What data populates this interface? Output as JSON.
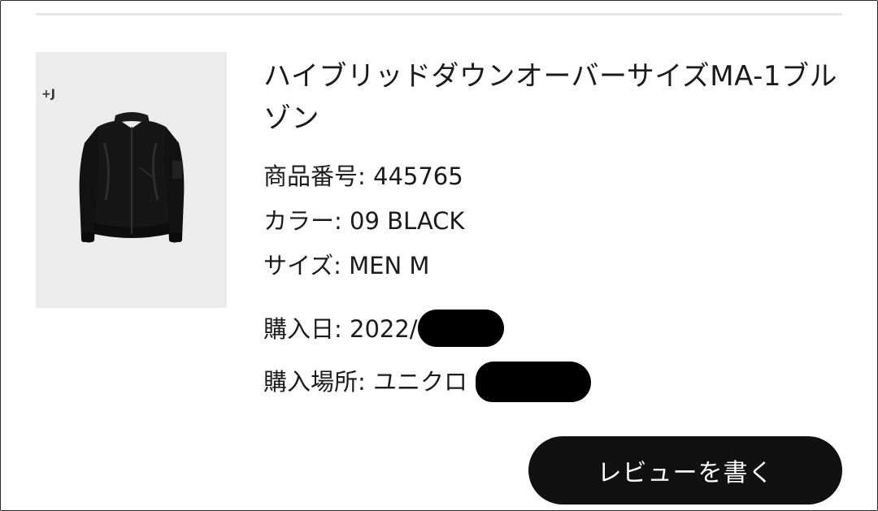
{
  "product": {
    "title": "ハイブリッドダウンオーバーサイズMA-1ブルゾン",
    "image_brand_mark": "+J",
    "image_icon": "jacket-icon"
  },
  "details": {
    "number_label": "商品番号: ",
    "number_value": "445765",
    "color_label": "カラー: ",
    "color_value": "09 BLACK",
    "size_label": "サイズ: ",
    "size_value": "MEN M"
  },
  "purchase": {
    "date_label": "購入日: ",
    "date_value": "2022/",
    "place_label": "購入場所: ",
    "place_value": "ユニクロ"
  },
  "actions": {
    "review_label": "レビューを書く"
  },
  "colors": {
    "button_bg": "#111111",
    "button_text": "#ffffff",
    "thumb_bg": "#ececec",
    "divider": "#e6e6e6",
    "redaction": "#000000"
  }
}
